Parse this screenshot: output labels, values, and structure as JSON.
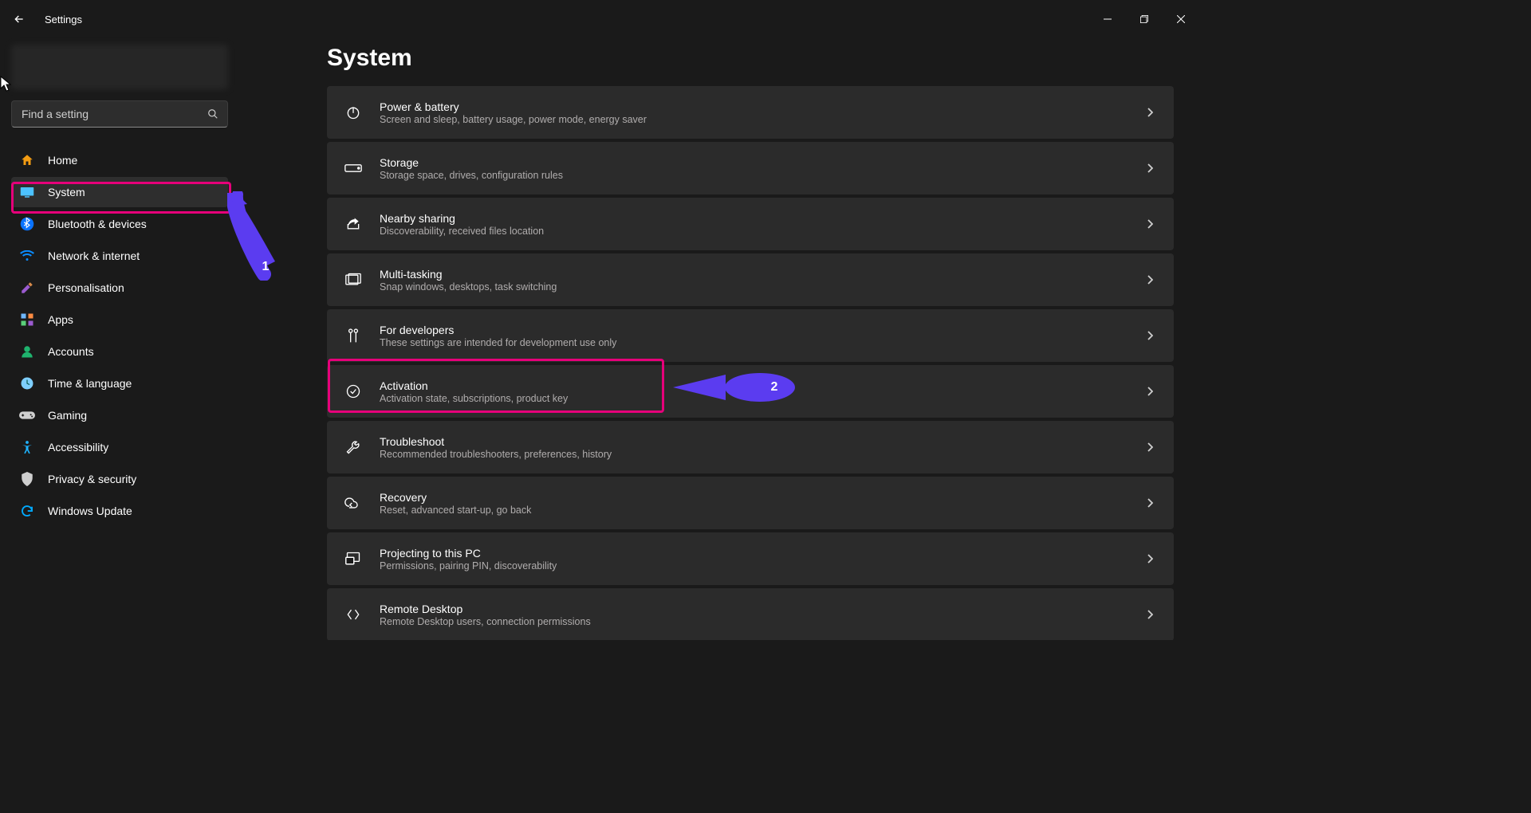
{
  "titlebar": {
    "label": "Settings"
  },
  "search": {
    "placeholder": "Find a setting"
  },
  "nav": {
    "items": [
      {
        "label": "Home",
        "icon": "home-icon",
        "color": "#f39c12"
      },
      {
        "label": "System",
        "icon": "system-icon",
        "color": "#4cc2ff",
        "selected": true
      },
      {
        "label": "Bluetooth & devices",
        "icon": "bluetooth-icon",
        "color": "#0a73ff"
      },
      {
        "label": "Network & internet",
        "icon": "network-icon",
        "color": "#0a8cff"
      },
      {
        "label": "Personalisation",
        "icon": "personalisation-icon",
        "color": "#9b5bd0"
      },
      {
        "label": "Apps",
        "icon": "apps-icon",
        "color": "#6fb7ff"
      },
      {
        "label": "Accounts",
        "icon": "accounts-icon",
        "color": "#1fb36e"
      },
      {
        "label": "Time & language",
        "icon": "time-language-icon",
        "color": "#7ecfff"
      },
      {
        "label": "Gaming",
        "icon": "gaming-icon",
        "color": "#cfcfcf"
      },
      {
        "label": "Accessibility",
        "icon": "accessibility-icon",
        "color": "#1fb3ff"
      },
      {
        "label": "Privacy & security",
        "icon": "privacy-icon",
        "color": "#cfcfcf"
      },
      {
        "label": "Windows Update",
        "icon": "update-icon",
        "color": "#00aaff"
      }
    ]
  },
  "page": {
    "title": "System"
  },
  "settings": {
    "items": [
      {
        "title": "Power & battery",
        "sub": "Screen and sleep, battery usage, power mode, energy saver",
        "icon": "power-icon"
      },
      {
        "title": "Storage",
        "sub": "Storage space, drives, configuration rules",
        "icon": "storage-icon"
      },
      {
        "title": "Nearby sharing",
        "sub": "Discoverability, received files location",
        "icon": "share-icon"
      },
      {
        "title": "Multi-tasking",
        "sub": "Snap windows, desktops, task switching",
        "icon": "multitask-icon"
      },
      {
        "title": "For developers",
        "sub": "These settings are intended for development use only",
        "icon": "developer-icon"
      },
      {
        "title": "Activation",
        "sub": "Activation state, subscriptions, product key",
        "icon": "activation-icon"
      },
      {
        "title": "Troubleshoot",
        "sub": "Recommended troubleshooters, preferences, history",
        "icon": "troubleshoot-icon"
      },
      {
        "title": "Recovery",
        "sub": "Reset, advanced start-up, go back",
        "icon": "recovery-icon"
      },
      {
        "title": "Projecting to this PC",
        "sub": "Permissions, pairing PIN, discoverability",
        "icon": "projecting-icon"
      },
      {
        "title": "Remote Desktop",
        "sub": "Remote Desktop users, connection permissions",
        "icon": "remote-desktop-icon"
      }
    ]
  },
  "annotations": {
    "arrow1": "1",
    "arrow2": "2",
    "color": "#5b3cf0",
    "highlight": "#e6007a"
  }
}
